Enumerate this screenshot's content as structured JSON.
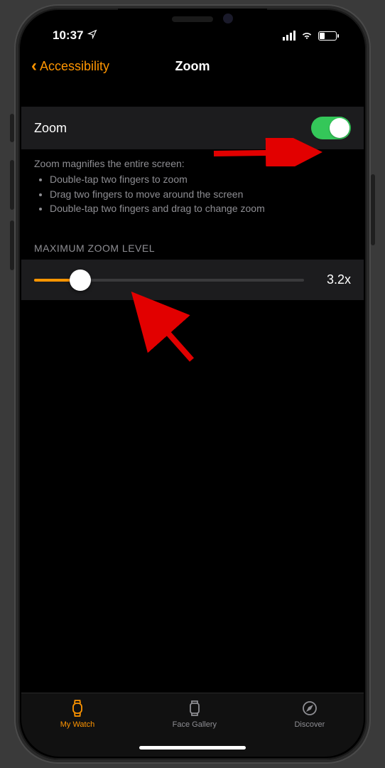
{
  "status": {
    "time": "10:37"
  },
  "nav": {
    "back_label": "Accessibility",
    "title": "Zoom"
  },
  "zoom_row": {
    "label": "Zoom",
    "enabled": true
  },
  "helper": {
    "heading": "Zoom magnifies the entire screen:",
    "items": [
      "Double-tap two fingers to zoom",
      "Drag two fingers to move around the screen",
      "Double-tap two fingers and drag to change zoom"
    ]
  },
  "slider": {
    "section_title": "MAXIMUM ZOOM LEVEL",
    "value_label": "3.2x",
    "percent": 17
  },
  "tabs": {
    "mywatch": "My Watch",
    "facegallery": "Face Gallery",
    "discover": "Discover"
  },
  "colors": {
    "accent": "#ff9500",
    "toggle_on": "#34c759"
  }
}
